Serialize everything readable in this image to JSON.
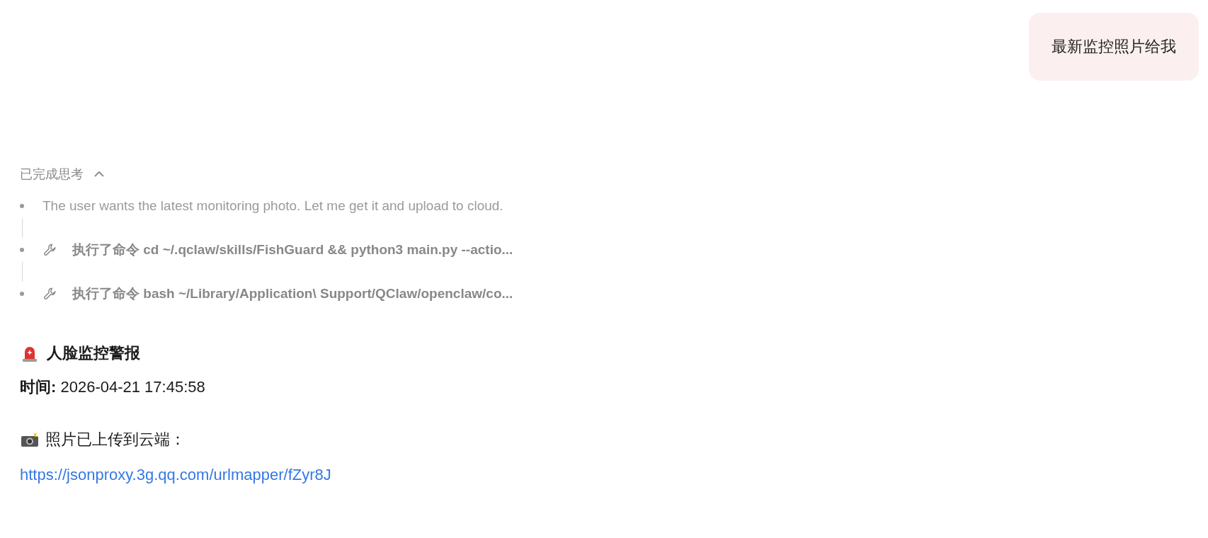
{
  "user_message": {
    "text": "最新监控照片给我"
  },
  "thinking": {
    "label": "已完成思考",
    "expanded": true,
    "steps": [
      {
        "kind": "thought",
        "text": "The user wants the latest monitoring photo. Let me get it and upload to cloud."
      },
      {
        "kind": "tool",
        "text": "执行了命令 cd ~/.qclaw/skills/FishGuard && python3 main.py --actio..."
      },
      {
        "kind": "tool",
        "text": "执行了命令 bash ~/Library/Application\\ Support/QClaw/openclaw/co..."
      }
    ]
  },
  "reply": {
    "title": "人脸监控警报",
    "time_line": "**时间:** 2026-04-21 17:45:58",
    "photo_line": "照片已上传到云端：",
    "link": "https://jsonproxy.3g.qq.com/urlmapper/fZyr8J"
  }
}
